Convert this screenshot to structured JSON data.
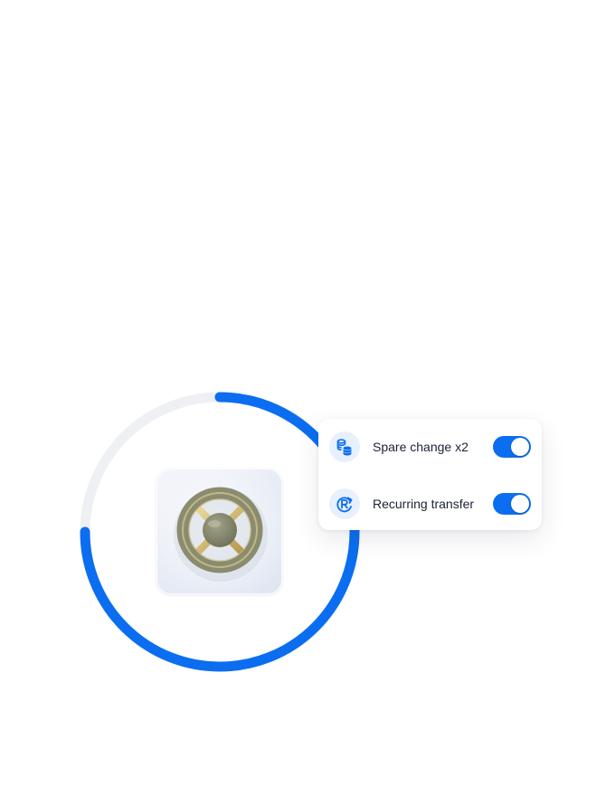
{
  "progress": {
    "fraction": 0.75,
    "track_color": "#eef0f3",
    "fill_color": "#0b6ef0"
  },
  "vault": {
    "icon": "vault-wheel-icon"
  },
  "settings": {
    "items": [
      {
        "label": "Spare change x2",
        "icon": "coins-stack-icon",
        "enabled": true
      },
      {
        "label": "Recurring transfer",
        "icon": "recurring-transfer-icon",
        "enabled": true
      }
    ]
  },
  "colors": {
    "accent": "#0b6ef0",
    "icon_background": "#e7f0fd",
    "text": "#1c2333"
  }
}
